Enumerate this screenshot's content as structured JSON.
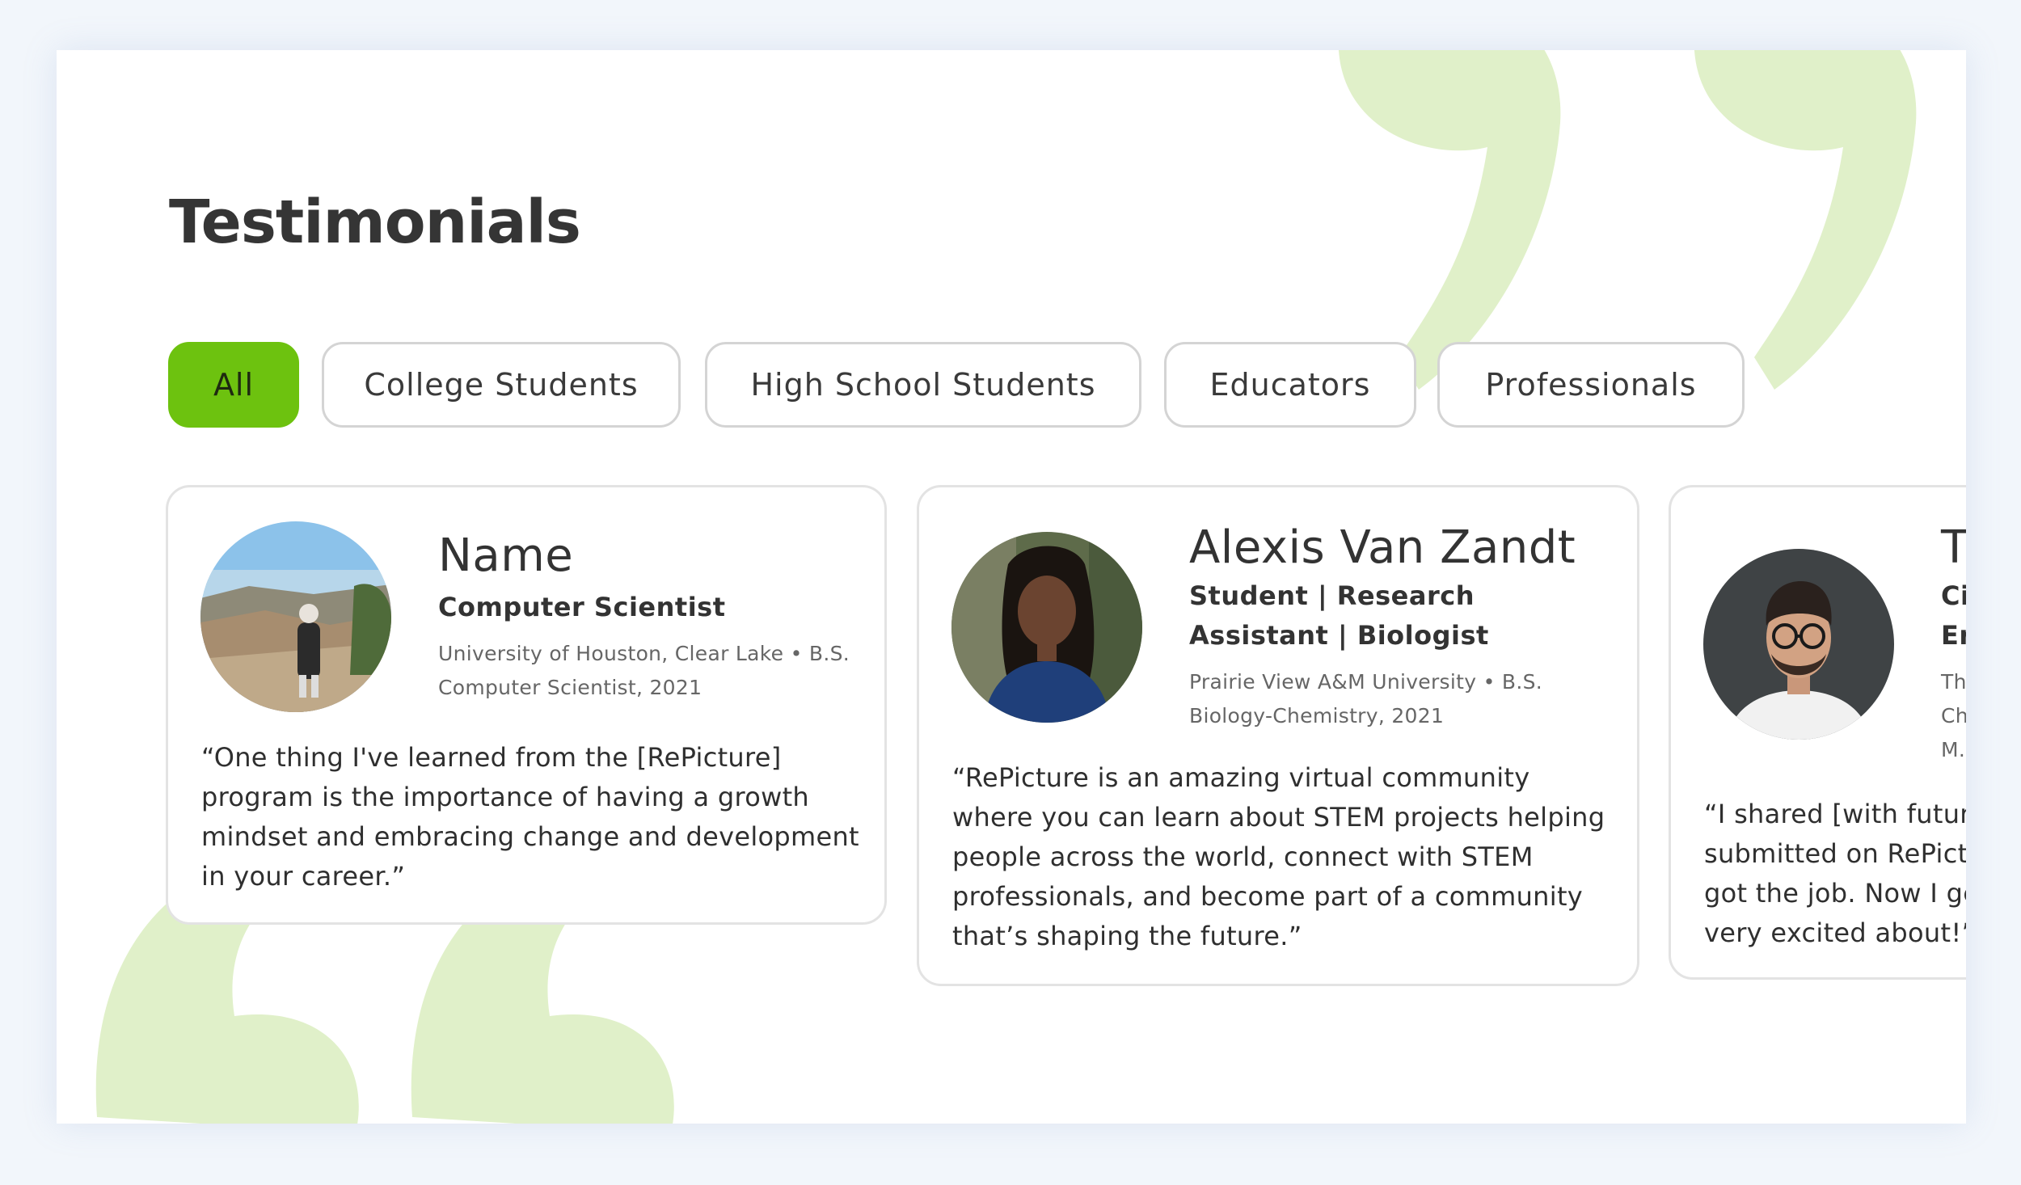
{
  "page": {
    "title": "Testimonials",
    "accent_color": "#6dc20f",
    "decoration_color": "#e0f0c9"
  },
  "filters": [
    {
      "label": "All",
      "active": true
    },
    {
      "label": "College Students",
      "active": false
    },
    {
      "label": "High School Students",
      "active": false
    },
    {
      "label": "Educators",
      "active": false
    },
    {
      "label": "Professionals",
      "active": false
    }
  ],
  "testimonials": [
    {
      "name": "Name",
      "role": "Computer Scientist",
      "education": "University of Houston, Clear Lake • B.S. Computer Scientist, 2021",
      "quote": "“One thing I've learned from the [RePicture] program is the importance of having a growth mindset and embracing change and development in your career.”",
      "photo": "person-outdoors-canyon-photo"
    },
    {
      "name": "Alexis Van Zandt",
      "role": "Student | Research Assistant | Biologist",
      "education": "Prairie View A&M University • B.S. Biology-Chemistry, 2021",
      "quote": "“RePicture is an amazing virtual community where you can learn about STEM projects helping people across the world, connect with STEM professionals, and become part of a community that’s shaping the future.”",
      "photo": "woman-portrait-photo"
    },
    {
      "name": "T",
      "role": "Ci Er",
      "education": "The Ch M.S",
      "quote": "“I shared [with future submitted on RePict got the job. Now I get very excited about!”",
      "photo": "man-with-glasses-photo"
    }
  ]
}
